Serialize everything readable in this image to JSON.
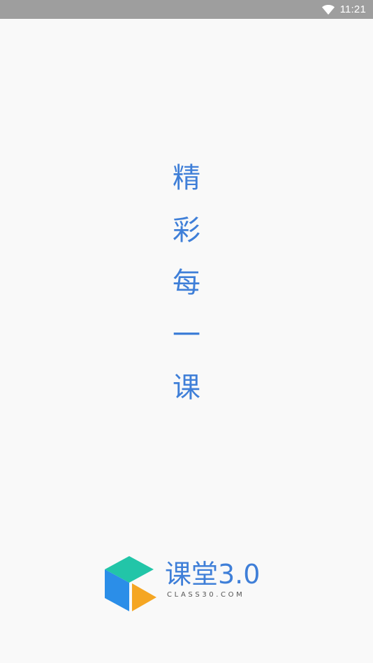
{
  "status_bar": {
    "time": "11:21",
    "wifi_icon": "wifi-icon"
  },
  "slogan": {
    "chars": [
      "精",
      "彩",
      "每",
      "一",
      "课"
    ]
  },
  "logo": {
    "brand_name": "课堂3.0",
    "domain": "CLASS30.COM",
    "icon": "cube-play-icon",
    "colors": {
      "brand_blue": "#3f7fd8",
      "cube_top": "#22c5a8",
      "cube_left": "#2b8ee8",
      "play": "#f5a623"
    }
  },
  "colors": {
    "status_bar_bg": "#9e9e9e",
    "page_bg": "#f9f9f9",
    "accent": "#3f7fd8"
  }
}
